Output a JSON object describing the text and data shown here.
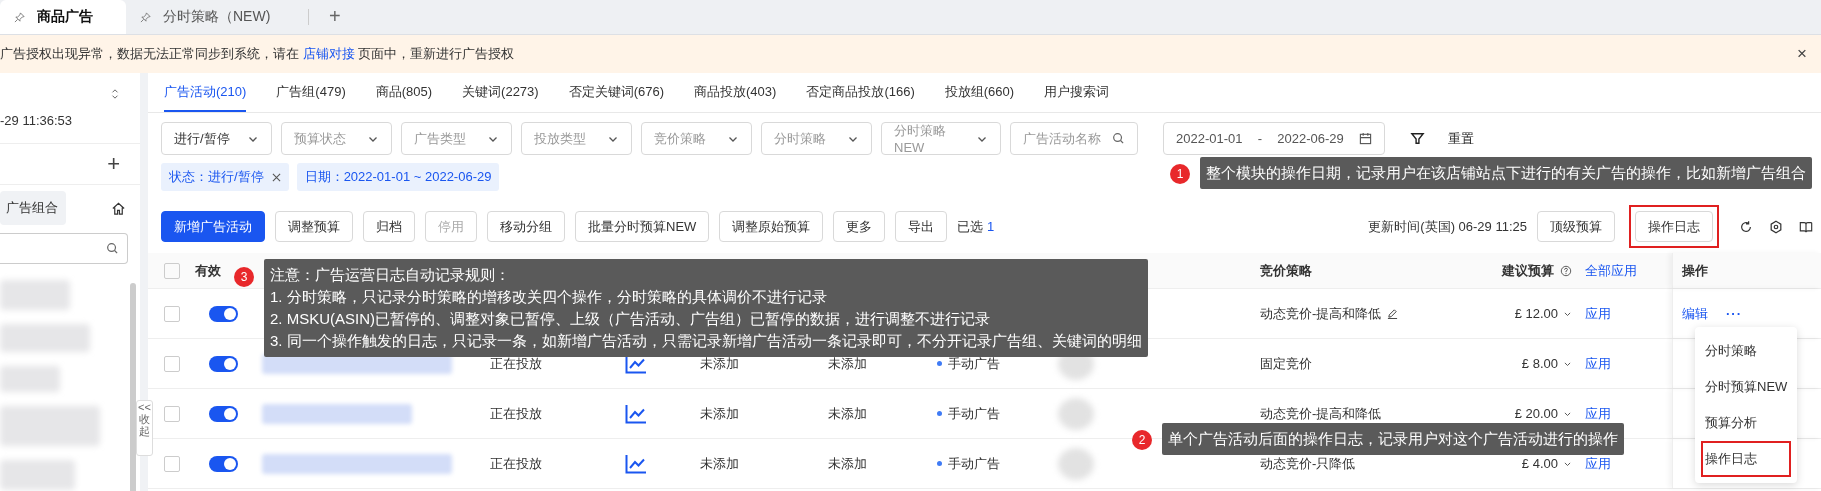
{
  "tabs": [
    {
      "label": "商品广告",
      "selected": true
    },
    {
      "label": "分时策略（NEW)",
      "selected": false
    }
  ],
  "new_tab": "+",
  "notice": {
    "text": "广告授权出现异常，数据无法正常同步到系统，请在 ",
    "link": "店铺对接",
    "text_after": " 页面中，重新进行广告授权",
    "close": "×"
  },
  "sidebar": {
    "timestamp": "-29 11:36:53",
    "add": "+",
    "group_tab": "广告组合",
    "collapse_arrow": "<<",
    "collapse": "收起"
  },
  "sub_tabs": [
    {
      "label": "广告活动(210)",
      "selected": true
    },
    {
      "label": "广告组(479)",
      "selected": false
    },
    {
      "label": "商品(805)",
      "selected": false
    },
    {
      "label": "关键词(2273)",
      "selected": false
    },
    {
      "label": "否定关键词(676)",
      "selected": false
    },
    {
      "label": "商品投放(403)",
      "selected": false
    },
    {
      "label": "否定商品投放(166)",
      "selected": false
    },
    {
      "label": "投放组(660)",
      "selected": false
    },
    {
      "label": "用户搜索词",
      "selected": false
    }
  ],
  "filters": [
    {
      "kind": "select",
      "value": "进行/暂停"
    },
    {
      "kind": "select",
      "placeholder": "预算状态"
    },
    {
      "kind": "select",
      "placeholder": "广告类型"
    },
    {
      "kind": "select",
      "placeholder": "投放类型"
    },
    {
      "kind": "select",
      "placeholder": "竞价策略"
    },
    {
      "kind": "select",
      "placeholder": "分时策略"
    },
    {
      "kind": "select",
      "placeholder": "分时策略NEW"
    },
    {
      "kind": "search",
      "placeholder": "广告活动名称"
    },
    {
      "kind": "date_range",
      "start": "2022-01-01",
      "separator": "-",
      "end": "2022-06-29"
    }
  ],
  "reset": "重置",
  "chips": [
    {
      "text": "状态：进行/暂停",
      "removable": true
    },
    {
      "text": "日期：2022-01-01 ~ 2022-06-29",
      "removable": false
    }
  ],
  "actions": [
    {
      "label": "新增广告活动",
      "primary": true,
      "disabled": false
    },
    {
      "label": "调整预算",
      "primary": false,
      "disabled": false
    },
    {
      "label": "归档",
      "primary": false,
      "disabled": false
    },
    {
      "label": "停用",
      "primary": false,
      "disabled": true
    },
    {
      "label": "移动分组",
      "primary": false,
      "disabled": false
    },
    {
      "label": "批量分时预算NEW",
      "primary": false,
      "disabled": false
    },
    {
      "label": "调整原始预算",
      "primary": false,
      "disabled": false
    },
    {
      "label": "更多",
      "primary": false,
      "disabled": false
    },
    {
      "label": "导出",
      "primary": false,
      "disabled": false
    }
  ],
  "selected_label": "已选",
  "selected_count": "1",
  "update_time": "更新时间(英国) 06-29 11:25",
  "right_buttons": [
    {
      "label": "顶级预算",
      "highlighted": false
    },
    {
      "label": "操作日志",
      "highlighted": true
    }
  ],
  "table": {
    "header_checked": false,
    "header": {
      "enabled": "有效",
      "bid_strategy": "竞价策略",
      "budget": "建议预算",
      "apply_all": "全部应用",
      "actions": "操作"
    },
    "rows": [
      {
        "checked": false,
        "on": true,
        "bid_strategy": "动态竞价-提高和降低",
        "bid_editable": true,
        "budget": "£ 12.00",
        "apply": "应用",
        "edit": "编辑",
        "more": "···"
      },
      {
        "checked": false,
        "on": true,
        "status": "正在投放",
        "time_new": "未添加",
        "time": "未添加",
        "ad_type": "手动广告",
        "bid_strategy": "固定竞价",
        "bid_editable": false,
        "budget": "£ 8.00",
        "apply": "应用"
      },
      {
        "checked": false,
        "on": true,
        "status": "正在投放",
        "time_new": "未添加",
        "time": "未添加",
        "ad_type": "手动广告",
        "bid_strategy": "动态竞价-提高和降低",
        "bid_editable": false,
        "budget": "£ 20.00",
        "apply": "应用"
      },
      {
        "checked": false,
        "on": true,
        "status": "正在投放",
        "time_new": "未添加",
        "time": "未添加",
        "ad_type": "手动广告",
        "bid_strategy": "动态竞价-只降低",
        "bid_editable": false,
        "budget": "£ 4.00",
        "apply": "应用"
      }
    ]
  },
  "menu": [
    {
      "label": "分时策略",
      "highlighted": false
    },
    {
      "label": "分时预算NEW",
      "highlighted": false
    },
    {
      "label": "预算分析",
      "highlighted": false
    },
    {
      "label": "操作日志",
      "highlighted": true
    }
  ],
  "annotations": [
    {
      "kind": "date",
      "number": "1",
      "lines": [
        "整个模块的操作日期，记录用户在该店铺站点下进行的有关广告的操作，比如新增广告组合"
      ]
    },
    {
      "kind": "row",
      "number": "2",
      "lines": [
        "单个广告活动后面的操作日志，记录用户对这个广告活动进行的操作"
      ]
    },
    {
      "kind": "rules",
      "number": "3",
      "lines": [
        "注意：广告运营日志自动记录规则：",
        "1. 分时策略，只记录分时策略的增移改关四个操作，分时策略的具体调价不进行记录",
        "2. MSKU(ASIN)已暂停的、调整对象已暂停、上级（广告活动、广告组）已暂停的数据，进行调整不进行记录",
        "3. 同一个操作触发的日志，只记录一条，如新增广告活动，只需记录新增广告活动一条记录即可，不分开记录广告组、关键词的明细"
      ]
    }
  ]
}
